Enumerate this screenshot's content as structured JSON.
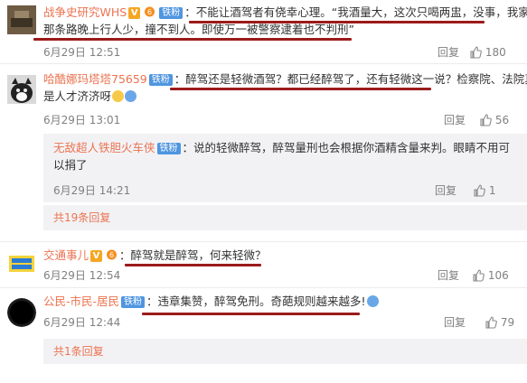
{
  "comments": [
    {
      "username": "战争史研究WHS",
      "badge": "铁粉",
      "text_line1": "不能让酒驾者有侥幸心理。“我酒量大，这次只喝两盅，没事，我家",
      "text_line2": "那条路晚上行人少，撞不到人。即使万一被警察逮着也不判刑”",
      "date": "6月29日 12:51",
      "reply": "回复",
      "likes": "180"
    },
    {
      "username": "哈酷娜玛塔塔75659",
      "badge": "铁粉",
      "text_line1": "醉驾还是轻微酒驾？都已经醉驾了，还有轻微这一说？检察院、法院真",
      "text_line2": "是人才济济呀",
      "date": "6月29日 13:01",
      "reply": "回复",
      "likes": "56"
    },
    {
      "username": "交通事儿",
      "text_line1": "醉驾就是醉驾，何来轻微？",
      "date": "6月29日 12:54",
      "reply": "回复",
      "likes": "106"
    },
    {
      "username": "公民-市民-居民",
      "badge": "铁粉",
      "text_line1": "违章集赞，醉驾免刑。奇葩规则越来越多!",
      "date": "6月29日 12:44",
      "reply": "回复",
      "likes": "79"
    }
  ],
  "sub_reply": {
    "username": "无敌超人铁胆火车侠",
    "badge": "铁粉",
    "text_line1": "说的轻微醉驾，醉驾量刑也会根据你酒精含量来判。眼睛不用可",
    "text_line2": "以捐了",
    "date": "6月29日 14:21",
    "reply": "回复",
    "likes": "1"
  },
  "more_replies_1": "共19条回复",
  "more_replies_2": "共1条回复",
  "colors": {
    "username": "#eb7350",
    "badge": "#4f95e0",
    "annotation": "#9b1b1b"
  }
}
